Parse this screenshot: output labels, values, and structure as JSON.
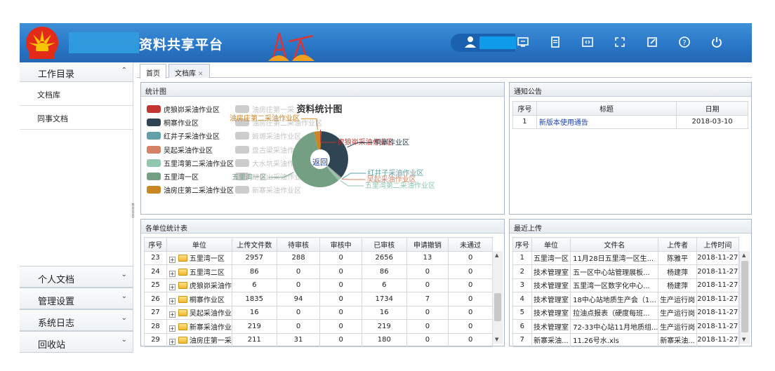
{
  "header": {
    "title": "资料共享平台"
  },
  "sidebar": {
    "head": "工作目录",
    "items": [
      {
        "label": "文档库"
      },
      {
        "label": "同事文档"
      }
    ],
    "bottom": [
      {
        "label": "个人文档"
      },
      {
        "label": "管理设置"
      },
      {
        "label": "系统日志"
      },
      {
        "label": "回收站"
      }
    ]
  },
  "tabs": [
    {
      "label": "首页"
    },
    {
      "label": "文档库"
    }
  ],
  "stats_panel": {
    "title": "统计图",
    "chart_title": "资料统计图",
    "back_label": "返回"
  },
  "chart_data": {
    "type": "pie",
    "title": "资料统计图",
    "legend": [
      {
        "name": "虎狼峁采油作业区",
        "color": "#c23531",
        "active": true
      },
      {
        "name": "桐寨作业区",
        "color": "#2f4554",
        "active": true
      },
      {
        "name": "红井子采油作业区",
        "color": "#61a0a8",
        "active": true
      },
      {
        "name": "吴起采油作业区",
        "color": "#d48265",
        "active": true
      },
      {
        "name": "五里湾第二采油作业区",
        "color": "#91c7ae",
        "active": true
      },
      {
        "name": "五里湾一区",
        "color": "#749f83",
        "active": true
      },
      {
        "name": "油房庄第二采油作业区",
        "color": "#ca8622",
        "active": true
      },
      {
        "name": "油房庄第一采",
        "color": "#cccccc",
        "active": false
      },
      {
        "name": "油房庄第二采油作业区",
        "color": "#cccccc",
        "active": false
      },
      {
        "name": "姬塬采油作业区",
        "color": "#cccccc",
        "active": false
      },
      {
        "name": "盘古梁采油作业区",
        "color": "#cccccc",
        "active": false
      },
      {
        "name": "大水坑采油作业区",
        "color": "#cccccc",
        "active": false
      },
      {
        "name": "胡尖山采油作业区",
        "color": "#cccccc",
        "active": false
      },
      {
        "name": "新寨采油作业区",
        "color": "#cccccc",
        "active": false
      }
    ],
    "slices": [
      {
        "name": "虎狼峁采油作业区",
        "value": 6,
        "color": "#c23531"
      },
      {
        "name": "桐寨作业区",
        "value": 1835,
        "color": "#2f4554"
      },
      {
        "name": "红井子采油作业区",
        "value": 4,
        "color": "#61a0a8"
      },
      {
        "name": "吴起采油作业区",
        "value": 16,
        "color": "#d48265"
      },
      {
        "name": "五里湾第二采油作业区",
        "value": 86,
        "color": "#91c7ae"
      },
      {
        "name": "五里湾一区",
        "value": 2957,
        "color": "#749f83"
      },
      {
        "name": "油房庄第二采油作业区",
        "value": 211,
        "color": "#ca8622"
      }
    ]
  },
  "notice_panel": {
    "title": "通知公告",
    "columns": [
      "序号",
      "标题",
      "日期"
    ],
    "rows": [
      {
        "no": "1",
        "title": "新版本使用通告",
        "date": "2018-03-10"
      }
    ]
  },
  "unit_panel": {
    "title": "各单位统计表",
    "columns": [
      "序号",
      "单位",
      "上传文件数",
      "待审核",
      "审核中",
      "已审核",
      "申请撤销",
      "未通过"
    ],
    "rows": [
      {
        "no": "23",
        "unit": "五里湾一区",
        "upload": "2957",
        "pending": "288",
        "reviewing": "0",
        "approved": "2656",
        "revoke": "13",
        "rejected": "0"
      },
      {
        "no": "24",
        "unit": "五里湾二区",
        "upload": "86",
        "pending": "0",
        "reviewing": "0",
        "approved": "86",
        "revoke": "0",
        "rejected": "0"
      },
      {
        "no": "25",
        "unit": "虎狼峁采油作",
        "upload": "6",
        "pending": "0",
        "reviewing": "0",
        "approved": "6",
        "revoke": "0",
        "rejected": "0"
      },
      {
        "no": "26",
        "unit": "桐寨作业区",
        "upload": "1835",
        "pending": "94",
        "reviewing": "0",
        "approved": "1734",
        "revoke": "7",
        "rejected": "0"
      },
      {
        "no": "27",
        "unit": "吴起采油作业",
        "upload": "16",
        "pending": "0",
        "reviewing": "0",
        "approved": "16",
        "revoke": "0",
        "rejected": "0"
      },
      {
        "no": "28",
        "unit": "新寨采油作业",
        "upload": "219",
        "pending": "0",
        "reviewing": "0",
        "approved": "219",
        "revoke": "0",
        "rejected": "0"
      },
      {
        "no": "29",
        "unit": "油房庄第一采",
        "upload": "211",
        "pending": "31",
        "reviewing": "0",
        "approved": "180",
        "revoke": "0",
        "rejected": "0"
      }
    ]
  },
  "recent_panel": {
    "title": "最近上传",
    "columns": [
      "序号",
      "单位",
      "文件名",
      "上传者",
      "上传时间"
    ],
    "rows": [
      {
        "no": "1",
        "unit": "五里湾一区",
        "file": "11月28日五里湾一区生...",
        "uploader": "陈雅平",
        "time": "2018-11-27"
      },
      {
        "no": "2",
        "unit": "技术管理室",
        "file": "五一区中心站管理展板...",
        "uploader": "杨建萍",
        "time": "2018-11-27"
      },
      {
        "no": "3",
        "unit": "技术管理室",
        "file": "五里湾一区数字化中心...",
        "uploader": "杨建萍",
        "time": "2018-11-27"
      },
      {
        "no": "4",
        "unit": "技术管理室",
        "file": "18中心站地质生产会（1...",
        "uploader": "生产运行岗",
        "time": "2018-11-27"
      },
      {
        "no": "5",
        "unit": "技术管理室",
        "file": "拉油点报表（硬度每班...",
        "uploader": "生产运行岗",
        "time": "2018-11-27"
      },
      {
        "no": "6",
        "unit": "技术管理室",
        "file": "72-33中心站11月地质组...",
        "uploader": "生产运行岗",
        "time": "2018-11-27"
      },
      {
        "no": "7",
        "unit": "新寨采油...",
        "file": "11.26号水.xls",
        "uploader": "新寨采油...",
        "time": "2018-11-27"
      }
    ]
  }
}
